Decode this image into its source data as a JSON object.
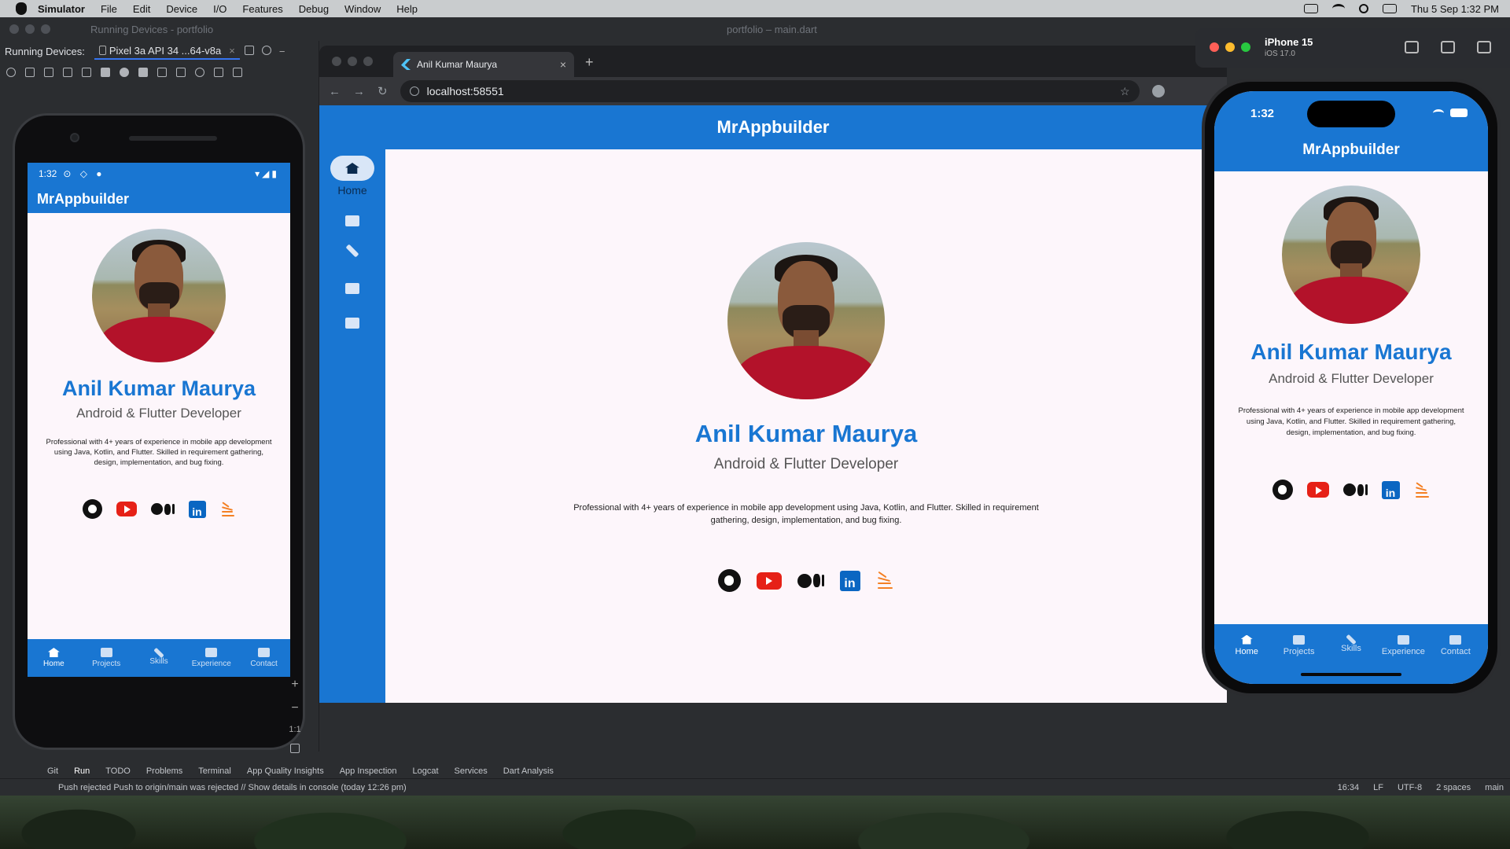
{
  "menubar": {
    "app": "Simulator",
    "items": [
      "File",
      "Edit",
      "Device",
      "I/O",
      "Features",
      "Debug",
      "Window",
      "Help"
    ],
    "datetime": "Thu 5 Sep  1:32 PM"
  },
  "ide": {
    "title_left": "Running Devices - portfolio",
    "title_center": "portfolio – main.dart",
    "running_devices_label": "Running Devices:",
    "device_tab": "Pixel 3a API 34 ...64-v8a",
    "zoom_plus": "+",
    "zoom_minus": "−",
    "zoom_ratio": "1:1",
    "tool_tabs": [
      "Git",
      "Run",
      "TODO",
      "Problems",
      "Terminal",
      "App Quality Insights",
      "App Inspection",
      "Logcat",
      "Services",
      "Dart Analysis"
    ],
    "status_message": "Push rejected Push to origin/main was rejected // Show details in console (today 12:26 pm)",
    "status_right": [
      "16:34",
      "LF",
      "UTF-8",
      "2 spaces",
      "main"
    ]
  },
  "profile": {
    "app_title": "MrAppbuilder",
    "name": "Anil Kumar Maurya",
    "role": "Android & Flutter Developer",
    "description": "Professional with 4+ years of experience in mobile app development using Java, Kotlin, and Flutter. Skilled in requirement gathering, design, implementation, and bug fixing.",
    "social_icons": [
      "github-icon",
      "youtube-icon",
      "medium-icon",
      "linkedin-icon",
      "stackoverflow-icon"
    ],
    "linkedin_glyph": "in",
    "nav": [
      "Home",
      "Projects",
      "Skills",
      "Experience",
      "Contact"
    ],
    "colors": {
      "primary": "#1976d2",
      "background": "#fdf6fb",
      "youtube": "#e62117",
      "linkedin": "#0a66c2",
      "stackoverflow": "#f48024"
    }
  },
  "android": {
    "time": "1:32",
    "status_icons": "⊙ ◇ ●",
    "signal": "▾◢▮"
  },
  "browser": {
    "tab_title": "Anil Kumar Maurya",
    "url": "localhost:58551",
    "new_tab": "+",
    "close": "×"
  },
  "rail": {
    "active_label": "Home"
  },
  "ios": {
    "device": "iPhone 15",
    "version": "iOS 17.0",
    "time": "1:32"
  }
}
